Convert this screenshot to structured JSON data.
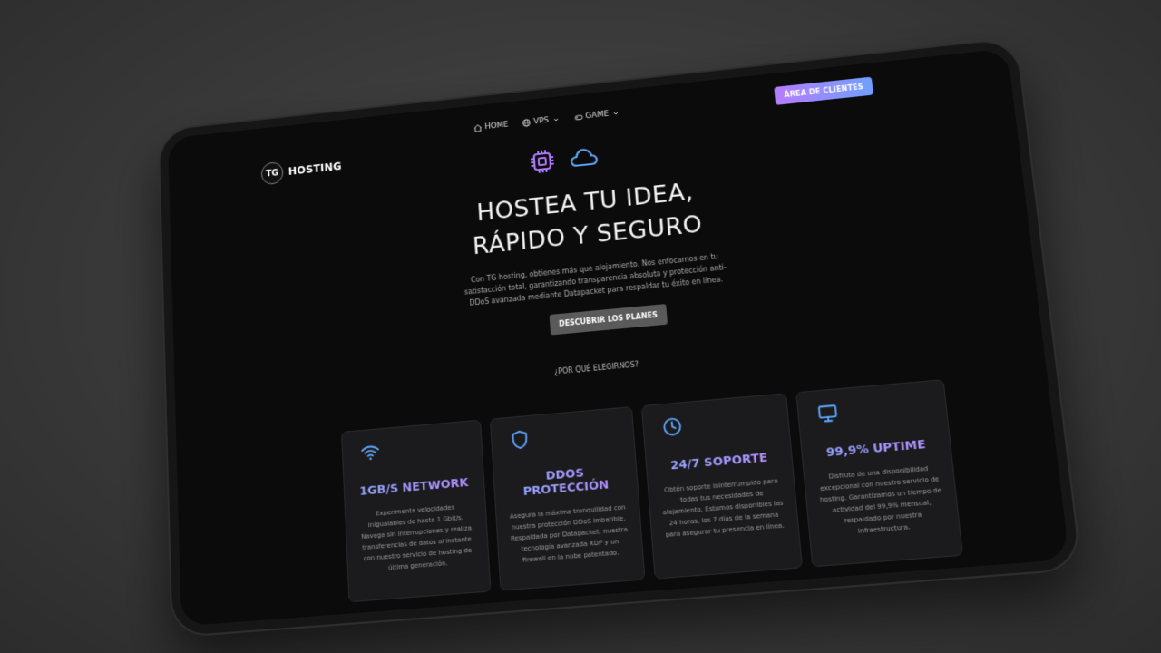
{
  "brand": {
    "mark": "TG",
    "name": "HOSTING"
  },
  "nav": {
    "items": [
      {
        "label": "HOME",
        "icon": "home-icon"
      },
      {
        "label": "VPS",
        "icon": "globe-icon",
        "dropdown": true
      },
      {
        "label": "GAME",
        "icon": "gamepad-icon",
        "dropdown": true
      }
    ]
  },
  "client_button": {
    "label": "ÁREA DE CLIENTES"
  },
  "hero": {
    "icons": [
      "cpu-icon",
      "cloud-icon"
    ],
    "title_line1": "HOSTEA TU IDEA,",
    "title_line2": "RÁPIDO Y SEGURO",
    "description": "Con TG hosting, obtienes más que alojamiento. Nos enfocamos en tu satisfacción total, garantizando transparencia absoluta y protección anti-DDoS avanzada mediante Datapacket para respaldar tu éxito en línea.",
    "cta": "DESCUBRIR LOS PLANES"
  },
  "why": {
    "label": "¿POR QUÉ ELEGIRNOS?"
  },
  "features": [
    {
      "icon": "wifi-icon",
      "title": "1GB/S NETWORK",
      "desc": "Experimenta velocidades inigualables de hasta 1 Gbit/s. Navega sin interrupciones y realiza transferencias de datos al instante con nuestro servicio de hosting de última generación."
    },
    {
      "icon": "shield-icon",
      "title": "DDOS PROTECCIÓN",
      "desc": "Asegura la máxima tranquilidad con nuestra protección DDoS imbatible. Respaldada por Datapacket, nuestra tecnología avanzada XDP y un firewall en la nube patentado."
    },
    {
      "icon": "clock-icon",
      "title": "24/7 SOPORTE",
      "desc": "Obtén soporte ininterrumpido para todas tus necesidades de alojamiento. Estamos disponibles las 24 horas, los 7 días de la semana para asegurar tu presencia en línea."
    },
    {
      "icon": "monitor-icon",
      "title": "99,9% UPTIME",
      "desc": "Disfruta de una disponibilidad excepcional con nuestro servicio de hosting. Garantizamos un tiempo de actividad del 99,9% mensual, respaldado por nuestra infraestructura."
    }
  ],
  "colors": {
    "accent_start": "#8fa6ff",
    "accent_end": "#b48cff",
    "icon_purple": "#b07cff",
    "icon_blue": "#5fa8ff"
  }
}
